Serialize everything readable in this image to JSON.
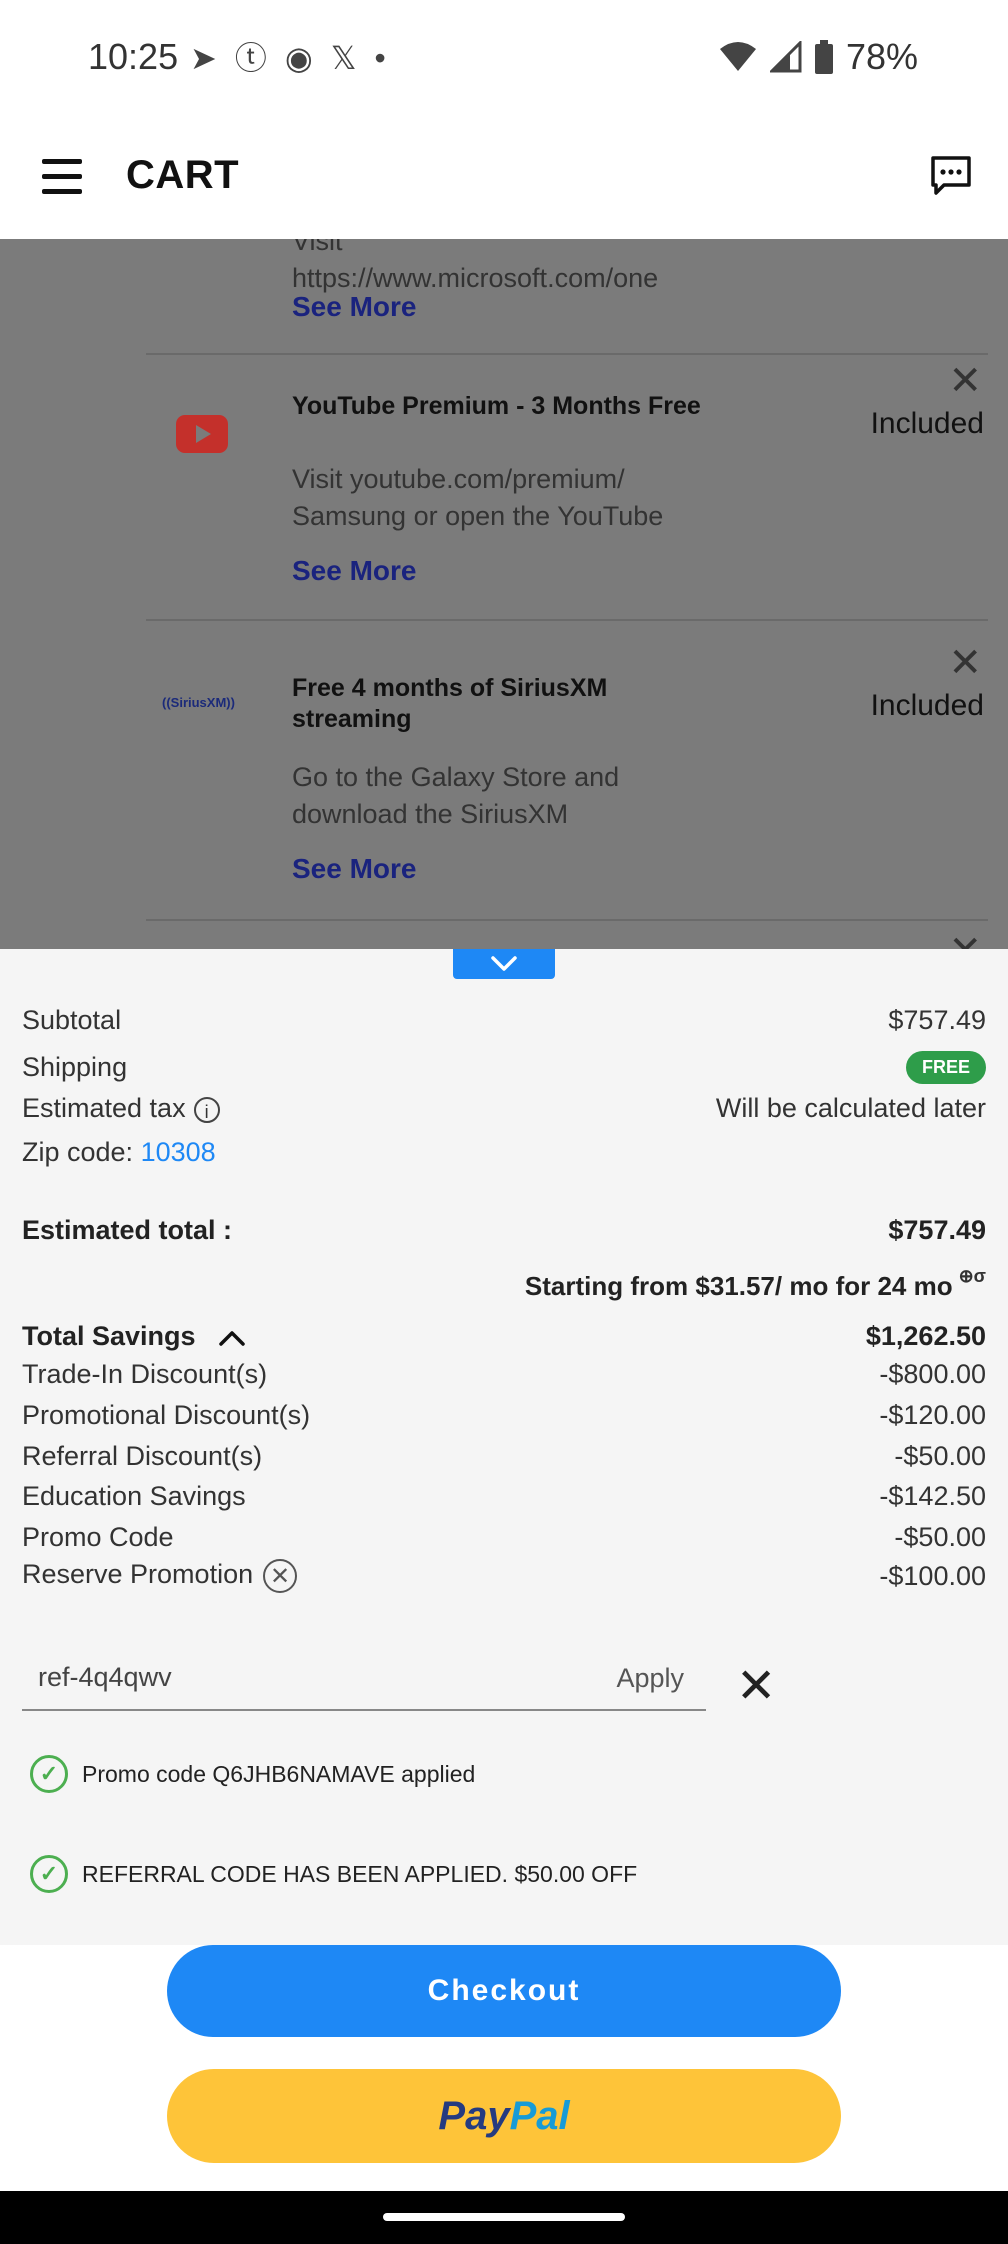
{
  "status_bar": {
    "time": "10:25",
    "battery": "78%",
    "notification_icons": [
      "telegram-icon",
      "tumblr-icon",
      "reddit-icon",
      "x-icon",
      "dot-icon"
    ]
  },
  "header": {
    "title": "CART"
  },
  "items": [
    {
      "name": "",
      "desc_line1": "Visit",
      "desc_line2": "https://www.microsoft.com/one",
      "see_more": "See More"
    },
    {
      "name": "YouTube Premium - 3 Months Free",
      "status": "Included",
      "desc_line1": "Visit youtube.com/premium/",
      "desc_line2": "Samsung or open the YouTube",
      "see_more": "See More"
    },
    {
      "name": "Free 4 months of SiriusXM streaming",
      "status": "Included",
      "logo_text": "((SiriusXM))",
      "desc_line1": "Go to the Galaxy Store and",
      "desc_line2": "download the SiriusXM",
      "see_more": "See More"
    }
  ],
  "summary": {
    "subtotal_label": "Subtotal",
    "subtotal_value": "$757.49",
    "shipping_label": "Shipping",
    "shipping_value": "FREE",
    "tax_label": "Estimated tax",
    "tax_value": "Will be calculated later",
    "zip_label": "Zip code:",
    "zip_value": "10308",
    "total_label": "Estimated total :",
    "total_value": "$757.49",
    "financing": "Starting from $31.57/ mo for 24 mo",
    "financing_mark": "⊕σ",
    "savings_label": "Total Savings",
    "savings_value": "$1,262.50",
    "discounts": [
      {
        "label": "Trade-In Discount(s)",
        "value": "-$800.00"
      },
      {
        "label": "Promotional Discount(s)",
        "value": "-$120.00"
      },
      {
        "label": "Referral Discount(s)",
        "value": "-$50.00"
      },
      {
        "label": "Education Savings",
        "value": "-$142.50"
      },
      {
        "label": "Promo Code",
        "value": "-$50.00"
      },
      {
        "label": "Reserve Promotion",
        "value": "-$100.00"
      }
    ]
  },
  "promo": {
    "input_value": "ref-4q4qwv",
    "apply_label": "Apply",
    "applied_msg_1": "Promo code Q6JHB6NAMAVE applied",
    "applied_msg_2": "REFERRAL CODE HAS BEEN APPLIED. $50.00 OFF"
  },
  "buttons": {
    "checkout": "Checkout",
    "paypal_1": "Pay",
    "paypal_2": "Pal"
  },
  "colors": {
    "accent": "#1e88f5",
    "paypal_yellow": "#fec439",
    "free_green": "#2e9d4a",
    "overlay_grey": "#7b7b7b"
  }
}
